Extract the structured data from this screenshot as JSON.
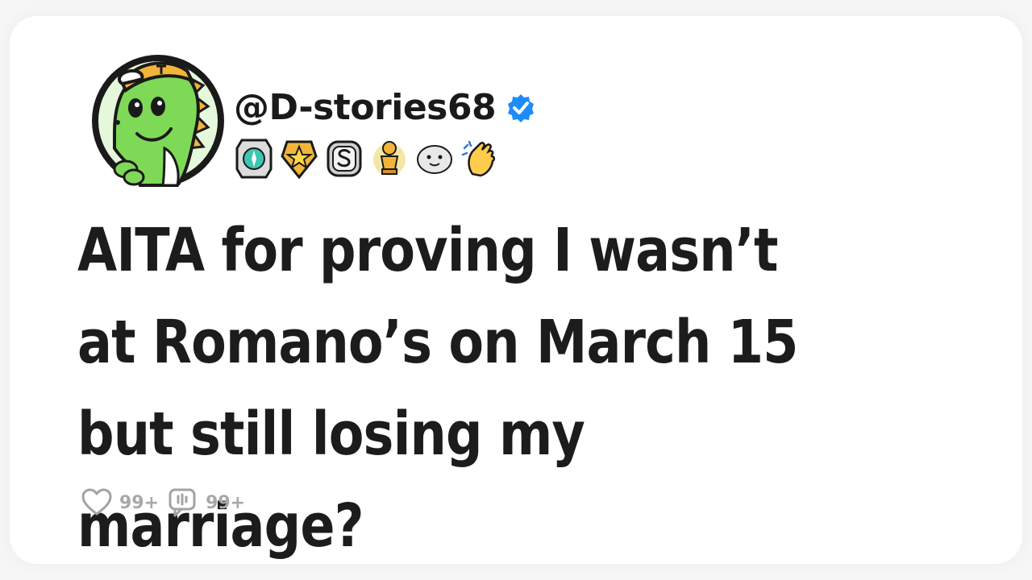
{
  "post": {
    "username": "@D-stories68",
    "verified": true,
    "title": "AITA for proving I wasn’t at Romano’s on March 15 but still losing my marriage?",
    "likes": "99+",
    "comments": "99+"
  },
  "badges": [
    "compass-badge",
    "star-badge",
    "s-coin-badge",
    "trophy-badge",
    "seal-badge",
    "clapping-hands-badge"
  ],
  "avatar": {
    "icon": "green-dinosaur-with-cap",
    "accent": "#8ed96a"
  },
  "colors": {
    "verified": "#1d8cf8",
    "text": "#1c1c1c",
    "muted": "#a3a3a3"
  }
}
